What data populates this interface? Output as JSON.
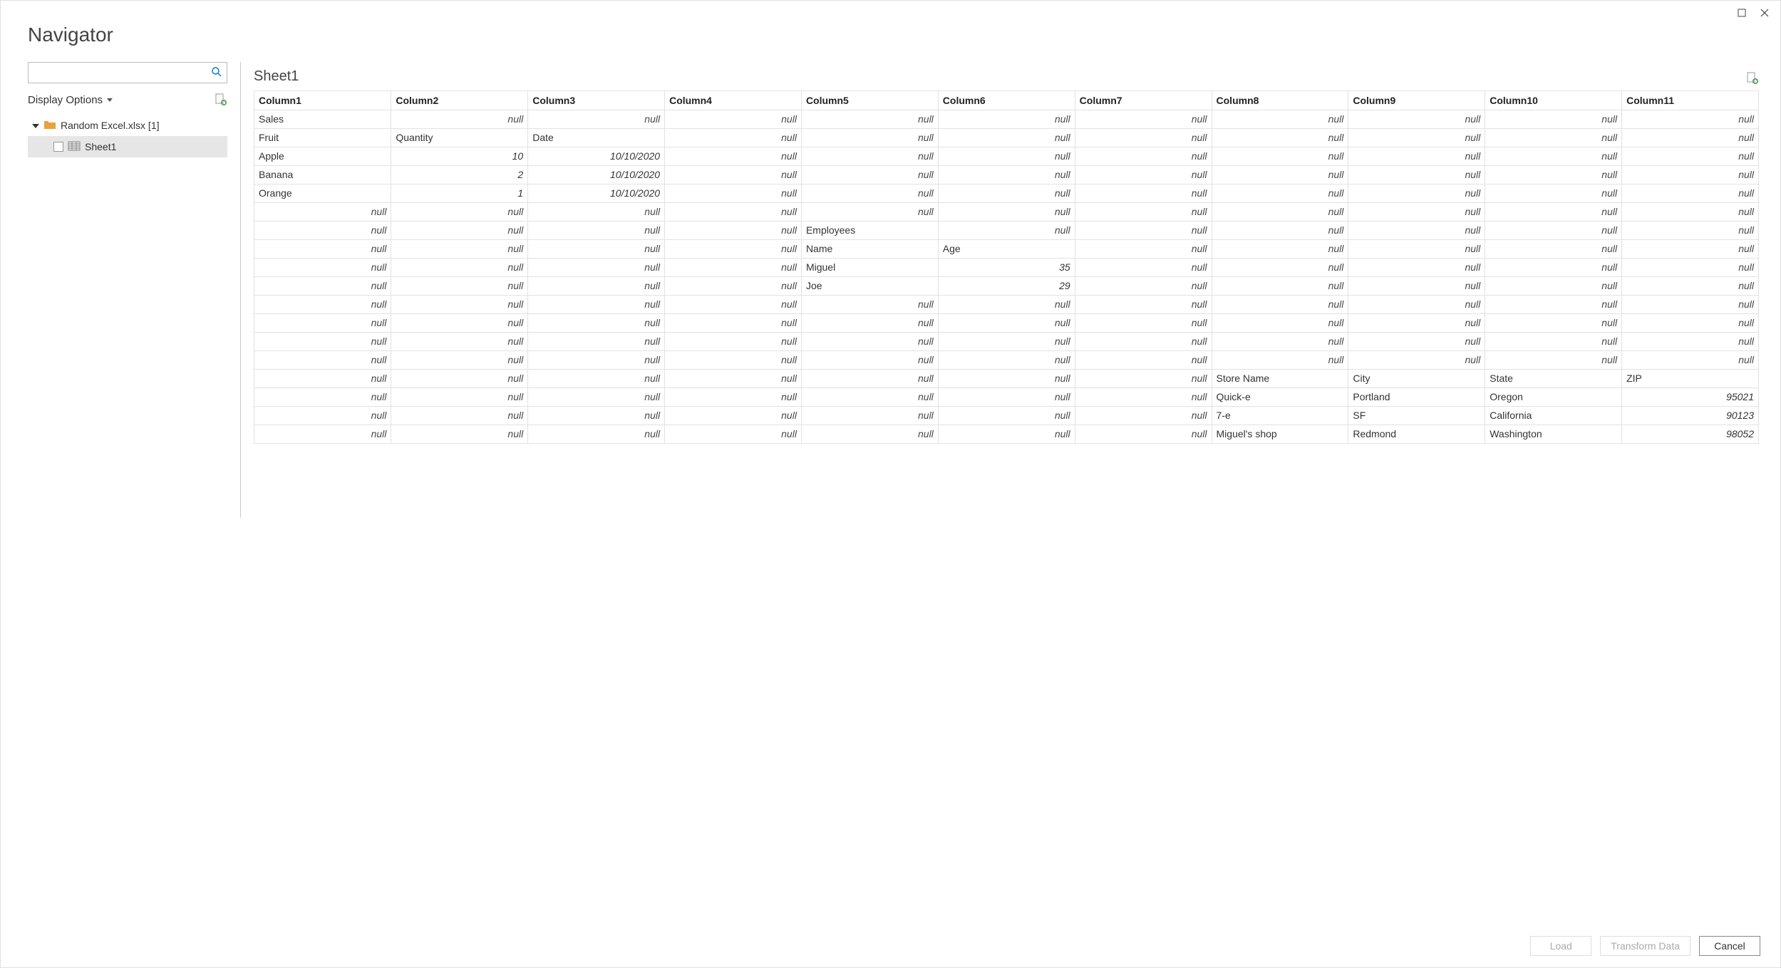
{
  "window": {
    "title": "Navigator"
  },
  "left": {
    "search_placeholder": "",
    "display_options_label": "Display Options",
    "tree": {
      "root_label": "Random Excel.xlsx [1]",
      "child_label": "Sheet1"
    }
  },
  "preview": {
    "title": "Sheet1",
    "columns": [
      "Column1",
      "Column2",
      "Column3",
      "Column4",
      "Column5",
      "Column6",
      "Column7",
      "Column8",
      "Column9",
      "Column10",
      "Column11"
    ],
    "null_label": "null",
    "rows": [
      [
        {
          "v": "Sales",
          "t": "text"
        },
        {
          "t": "null"
        },
        {
          "t": "null"
        },
        {
          "t": "null"
        },
        {
          "t": "null"
        },
        {
          "t": "null"
        },
        {
          "t": "null"
        },
        {
          "t": "null"
        },
        {
          "t": "null"
        },
        {
          "t": "null"
        },
        {
          "t": "null"
        }
      ],
      [
        {
          "v": "Fruit",
          "t": "text"
        },
        {
          "v": "Quantity",
          "t": "text"
        },
        {
          "v": "Date",
          "t": "text"
        },
        {
          "t": "null"
        },
        {
          "t": "null"
        },
        {
          "t": "null"
        },
        {
          "t": "null"
        },
        {
          "t": "null"
        },
        {
          "t": "null"
        },
        {
          "t": "null"
        },
        {
          "t": "null"
        }
      ],
      [
        {
          "v": "Apple",
          "t": "text"
        },
        {
          "v": "10",
          "t": "num"
        },
        {
          "v": "10/10/2020",
          "t": "num"
        },
        {
          "t": "null"
        },
        {
          "t": "null"
        },
        {
          "t": "null"
        },
        {
          "t": "null"
        },
        {
          "t": "null"
        },
        {
          "t": "null"
        },
        {
          "t": "null"
        },
        {
          "t": "null"
        }
      ],
      [
        {
          "v": "Banana",
          "t": "text"
        },
        {
          "v": "2",
          "t": "num"
        },
        {
          "v": "10/10/2020",
          "t": "num"
        },
        {
          "t": "null"
        },
        {
          "t": "null"
        },
        {
          "t": "null"
        },
        {
          "t": "null"
        },
        {
          "t": "null"
        },
        {
          "t": "null"
        },
        {
          "t": "null"
        },
        {
          "t": "null"
        }
      ],
      [
        {
          "v": "Orange",
          "t": "text"
        },
        {
          "v": "1",
          "t": "num"
        },
        {
          "v": "10/10/2020",
          "t": "num"
        },
        {
          "t": "null"
        },
        {
          "t": "null"
        },
        {
          "t": "null"
        },
        {
          "t": "null"
        },
        {
          "t": "null"
        },
        {
          "t": "null"
        },
        {
          "t": "null"
        },
        {
          "t": "null"
        }
      ],
      [
        {
          "t": "null"
        },
        {
          "t": "null"
        },
        {
          "t": "null"
        },
        {
          "t": "null"
        },
        {
          "t": "null"
        },
        {
          "t": "null"
        },
        {
          "t": "null"
        },
        {
          "t": "null"
        },
        {
          "t": "null"
        },
        {
          "t": "null"
        },
        {
          "t": "null"
        }
      ],
      [
        {
          "t": "null"
        },
        {
          "t": "null"
        },
        {
          "t": "null"
        },
        {
          "t": "null"
        },
        {
          "v": "Employees",
          "t": "text"
        },
        {
          "t": "null"
        },
        {
          "t": "null"
        },
        {
          "t": "null"
        },
        {
          "t": "null"
        },
        {
          "t": "null"
        },
        {
          "t": "null"
        }
      ],
      [
        {
          "t": "null"
        },
        {
          "t": "null"
        },
        {
          "t": "null"
        },
        {
          "t": "null"
        },
        {
          "v": "Name",
          "t": "text"
        },
        {
          "v": "Age",
          "t": "text"
        },
        {
          "t": "null"
        },
        {
          "t": "null"
        },
        {
          "t": "null"
        },
        {
          "t": "null"
        },
        {
          "t": "null"
        }
      ],
      [
        {
          "t": "null"
        },
        {
          "t": "null"
        },
        {
          "t": "null"
        },
        {
          "t": "null"
        },
        {
          "v": "Miguel",
          "t": "text"
        },
        {
          "v": "35",
          "t": "num"
        },
        {
          "t": "null"
        },
        {
          "t": "null"
        },
        {
          "t": "null"
        },
        {
          "t": "null"
        },
        {
          "t": "null"
        }
      ],
      [
        {
          "t": "null"
        },
        {
          "t": "null"
        },
        {
          "t": "null"
        },
        {
          "t": "null"
        },
        {
          "v": "Joe",
          "t": "text"
        },
        {
          "v": "29",
          "t": "num"
        },
        {
          "t": "null"
        },
        {
          "t": "null"
        },
        {
          "t": "null"
        },
        {
          "t": "null"
        },
        {
          "t": "null"
        }
      ],
      [
        {
          "t": "null"
        },
        {
          "t": "null"
        },
        {
          "t": "null"
        },
        {
          "t": "null"
        },
        {
          "t": "null"
        },
        {
          "t": "null"
        },
        {
          "t": "null"
        },
        {
          "t": "null"
        },
        {
          "t": "null"
        },
        {
          "t": "null"
        },
        {
          "t": "null"
        }
      ],
      [
        {
          "t": "null"
        },
        {
          "t": "null"
        },
        {
          "t": "null"
        },
        {
          "t": "null"
        },
        {
          "t": "null"
        },
        {
          "t": "null"
        },
        {
          "t": "null"
        },
        {
          "t": "null"
        },
        {
          "t": "null"
        },
        {
          "t": "null"
        },
        {
          "t": "null"
        }
      ],
      [
        {
          "t": "null"
        },
        {
          "t": "null"
        },
        {
          "t": "null"
        },
        {
          "t": "null"
        },
        {
          "t": "null"
        },
        {
          "t": "null"
        },
        {
          "t": "null"
        },
        {
          "t": "null"
        },
        {
          "t": "null"
        },
        {
          "t": "null"
        },
        {
          "t": "null"
        }
      ],
      [
        {
          "t": "null"
        },
        {
          "t": "null"
        },
        {
          "t": "null"
        },
        {
          "t": "null"
        },
        {
          "t": "null"
        },
        {
          "t": "null"
        },
        {
          "t": "null"
        },
        {
          "t": "null"
        },
        {
          "t": "null"
        },
        {
          "t": "null"
        },
        {
          "t": "null"
        }
      ],
      [
        {
          "t": "null"
        },
        {
          "t": "null"
        },
        {
          "t": "null"
        },
        {
          "t": "null"
        },
        {
          "t": "null"
        },
        {
          "t": "null"
        },
        {
          "t": "null"
        },
        {
          "v": "Store Name",
          "t": "text"
        },
        {
          "v": "City",
          "t": "text"
        },
        {
          "v": "State",
          "t": "text"
        },
        {
          "v": "ZIP",
          "t": "text"
        }
      ],
      [
        {
          "t": "null"
        },
        {
          "t": "null"
        },
        {
          "t": "null"
        },
        {
          "t": "null"
        },
        {
          "t": "null"
        },
        {
          "t": "null"
        },
        {
          "t": "null"
        },
        {
          "v": "Quick-e",
          "t": "text"
        },
        {
          "v": "Portland",
          "t": "text"
        },
        {
          "v": "Oregon",
          "t": "text"
        },
        {
          "v": "95021",
          "t": "num"
        }
      ],
      [
        {
          "t": "null"
        },
        {
          "t": "null"
        },
        {
          "t": "null"
        },
        {
          "t": "null"
        },
        {
          "t": "null"
        },
        {
          "t": "null"
        },
        {
          "t": "null"
        },
        {
          "v": "7-e",
          "t": "text"
        },
        {
          "v": "SF",
          "t": "text"
        },
        {
          "v": "California",
          "t": "text"
        },
        {
          "v": "90123",
          "t": "num"
        }
      ],
      [
        {
          "t": "null"
        },
        {
          "t": "null"
        },
        {
          "t": "null"
        },
        {
          "t": "null"
        },
        {
          "t": "null"
        },
        {
          "t": "null"
        },
        {
          "t": "null"
        },
        {
          "v": "Miguel's shop",
          "t": "text"
        },
        {
          "v": "Redmond",
          "t": "text"
        },
        {
          "v": "Washington",
          "t": "text"
        },
        {
          "v": "98052",
          "t": "num"
        }
      ]
    ]
  },
  "footer": {
    "load_label": "Load",
    "transform_label": "Transform Data",
    "cancel_label": "Cancel"
  }
}
